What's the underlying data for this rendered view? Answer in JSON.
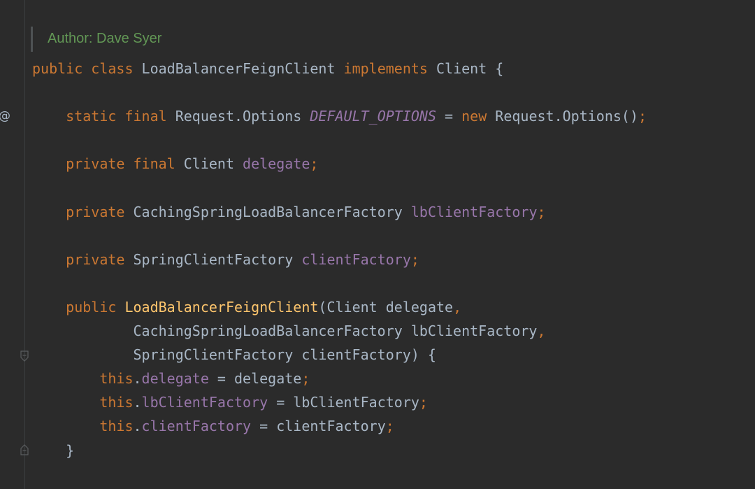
{
  "doc_comment": "Author: Dave Syer",
  "gutter": {
    "marker": "@"
  },
  "lines": [
    [
      {
        "t": "public class",
        "c": "kw"
      },
      {
        "t": " ",
        "c": "pl"
      },
      {
        "t": "LoadBalancerFeignClient",
        "c": "tp"
      },
      {
        "t": " ",
        "c": "pl"
      },
      {
        "t": "implements",
        "c": "kw"
      },
      {
        "t": " Client {",
        "c": "pl"
      }
    ],
    [],
    [
      {
        "t": "    ",
        "c": "pl"
      },
      {
        "t": "static final",
        "c": "kw"
      },
      {
        "t": " Request.Options ",
        "c": "pl"
      },
      {
        "t": "DEFAULT_OPTIONS",
        "c": "stat"
      },
      {
        "t": " = ",
        "c": "pl"
      },
      {
        "t": "new",
        "c": "kw"
      },
      {
        "t": " Request.Options()",
        "c": "pl"
      },
      {
        "t": ";",
        "c": "pu"
      }
    ],
    [],
    [
      {
        "t": "    ",
        "c": "pl"
      },
      {
        "t": "private final",
        "c": "kw"
      },
      {
        "t": " Client ",
        "c": "pl"
      },
      {
        "t": "delegate",
        "c": "fld"
      },
      {
        "t": ";",
        "c": "pu"
      }
    ],
    [],
    [
      {
        "t": "    ",
        "c": "pl"
      },
      {
        "t": "private",
        "c": "kw"
      },
      {
        "t": " CachingSpringLoadBalancerFactory ",
        "c": "pl"
      },
      {
        "t": "lbClientFactory",
        "c": "fld"
      },
      {
        "t": ";",
        "c": "pu"
      }
    ],
    [],
    [
      {
        "t": "    ",
        "c": "pl"
      },
      {
        "t": "private",
        "c": "kw"
      },
      {
        "t": " SpringClientFactory ",
        "c": "pl"
      },
      {
        "t": "clientFactory",
        "c": "fld"
      },
      {
        "t": ";",
        "c": "pu"
      }
    ],
    [],
    [
      {
        "t": "    ",
        "c": "pl"
      },
      {
        "t": "public",
        "c": "kw"
      },
      {
        "t": " ",
        "c": "pl"
      },
      {
        "t": "LoadBalancerFeignClient",
        "c": "fn"
      },
      {
        "t": "(Client delegate",
        "c": "pl"
      },
      {
        "t": ",",
        "c": "pu"
      }
    ],
    [
      {
        "t": "            CachingSpringLoadBalancerFactory lbClientFactory",
        "c": "pl"
      },
      {
        "t": ",",
        "c": "pu"
      }
    ],
    [
      {
        "t": "            SpringClientFactory clientFactory) {",
        "c": "pl"
      }
    ],
    [
      {
        "t": "        ",
        "c": "pl"
      },
      {
        "t": "this",
        "c": "kw"
      },
      {
        "t": ".",
        "c": "pl"
      },
      {
        "t": "delegate",
        "c": "fld"
      },
      {
        "t": " = delegate",
        "c": "pl"
      },
      {
        "t": ";",
        "c": "pu"
      }
    ],
    [
      {
        "t": "        ",
        "c": "pl"
      },
      {
        "t": "this",
        "c": "kw"
      },
      {
        "t": ".",
        "c": "pl"
      },
      {
        "t": "lbClientFactory",
        "c": "fld"
      },
      {
        "t": " = lbClientFactory",
        "c": "pl"
      },
      {
        "t": ";",
        "c": "pu"
      }
    ],
    [
      {
        "t": "        ",
        "c": "pl"
      },
      {
        "t": "this",
        "c": "kw"
      },
      {
        "t": ".",
        "c": "pl"
      },
      {
        "t": "clientFactory",
        "c": "fld"
      },
      {
        "t": " = clientFactory",
        "c": "pl"
      },
      {
        "t": ";",
        "c": "pu"
      }
    ],
    [
      {
        "t": "    }",
        "c": "pl"
      }
    ]
  ]
}
